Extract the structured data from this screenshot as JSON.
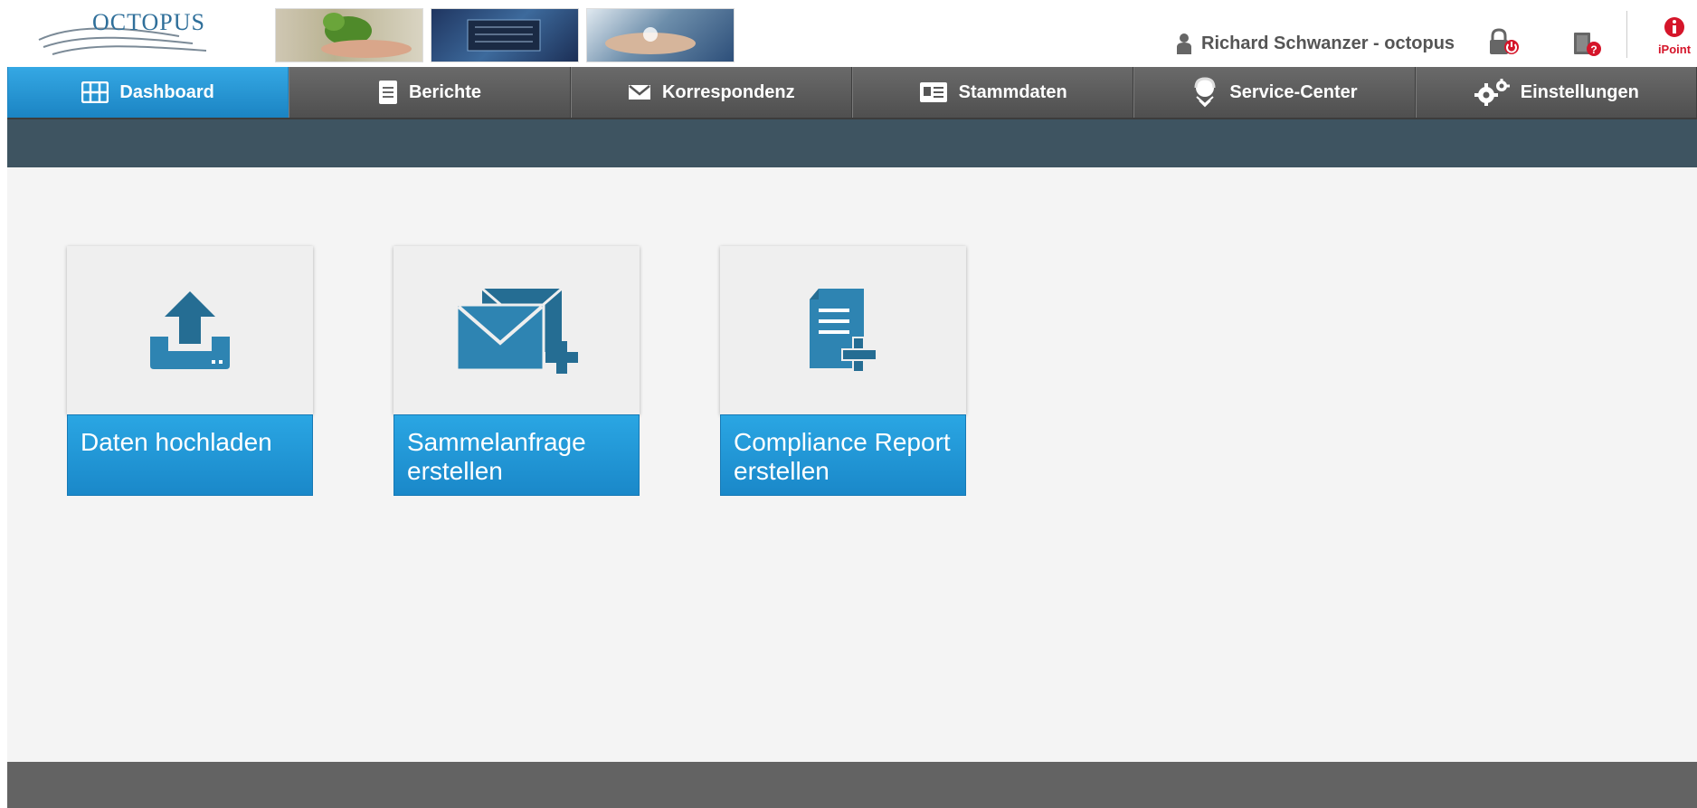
{
  "header": {
    "logo_text": "OCTOPUS",
    "user_name": "Richard Schwanzer - octopus",
    "ipoint_label": "iPoint"
  },
  "nav": {
    "items": [
      {
        "label": "Dashboard",
        "icon": "grid-icon",
        "active": true
      },
      {
        "label": "Berichte",
        "icon": "document-icon"
      },
      {
        "label": "Korrespondenz",
        "icon": "envelope-icon"
      },
      {
        "label": "Stammdaten",
        "icon": "id-card-icon"
      },
      {
        "label": "Service-Center",
        "icon": "headset-icon"
      },
      {
        "label": "Einstellungen",
        "icon": "gears-icon"
      }
    ]
  },
  "tiles": [
    {
      "label": "Daten hochladen",
      "icon": "upload-icon"
    },
    {
      "label": "Sammelanfrage erstellen",
      "icon": "envelopes-plus-icon"
    },
    {
      "label": "Compliance Report erstellen",
      "icon": "document-plus-icon"
    }
  ],
  "colors": {
    "accent": "#1f8fd0",
    "nav_bg": "#5a5a5a",
    "subbar": "#3e5461",
    "icon_blue": "#2b6f95",
    "ipoint_red": "#d5152a"
  }
}
